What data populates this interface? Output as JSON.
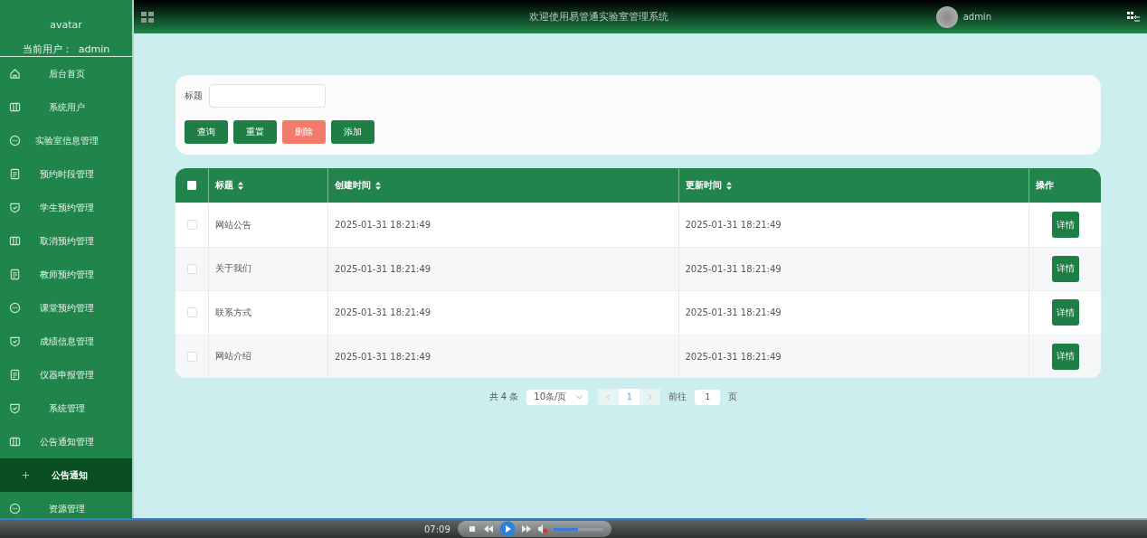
{
  "sidebar": {
    "avatar_alt": "avatar",
    "current_user": "当前用户：  admin",
    "items": [
      {
        "label": "后台首页",
        "kind": "home",
        "selected": false
      },
      {
        "label": "系统用户",
        "kind": "columns",
        "selected": false
      },
      {
        "label": "实验室信息管理",
        "kind": "chat",
        "selected": false
      },
      {
        "label": "预约时段管理",
        "kind": "doc",
        "selected": false
      },
      {
        "label": "学生预约管理",
        "kind": "shield",
        "selected": false
      },
      {
        "label": "取消预约管理",
        "kind": "columns",
        "selected": false
      },
      {
        "label": "教师预约管理",
        "kind": "doc",
        "selected": false
      },
      {
        "label": "课堂预约管理",
        "kind": "chat",
        "selected": false
      },
      {
        "label": "成绩信息管理",
        "kind": "shield",
        "selected": false
      },
      {
        "label": "仪器申报管理",
        "kind": "doc",
        "selected": false
      },
      {
        "label": "系统管理",
        "kind": "shield",
        "selected": false
      },
      {
        "label": "公告通知管理",
        "kind": "columns",
        "selected": false
      },
      {
        "label": "公告通知",
        "kind": "sub",
        "selected": true
      },
      {
        "label": "资源管理",
        "kind": "chat",
        "selected": false
      }
    ]
  },
  "header": {
    "title": "欢迎使用易管通实验室管理系统",
    "user": "admin"
  },
  "search": {
    "label": "标题",
    "buttons": [
      {
        "label": "查询",
        "kind": "primary"
      },
      {
        "label": "重置",
        "kind": "primary"
      },
      {
        "label": "删除",
        "kind": "danger"
      },
      {
        "label": "添加",
        "kind": "primary"
      }
    ]
  },
  "table": {
    "all_checked": false,
    "columns": [
      "标题",
      "创建时间",
      "更新时间",
      "操作"
    ],
    "rows": [
      {
        "title": "网站公告",
        "created": "2025-01-31 18:21:49",
        "updated": "2025-01-31 18:21:49",
        "action": "详情",
        "checked": false
      },
      {
        "title": "关于我们",
        "created": "2025-01-31 18:21:49",
        "updated": "2025-01-31 18:21:49",
        "action": "详情",
        "checked": false
      },
      {
        "title": "联系方式",
        "created": "2025-01-31 18:21:49",
        "updated": "2025-01-31 18:21:49",
        "action": "详情",
        "checked": false
      },
      {
        "title": "网站介绍",
        "created": "2025-01-31 18:21:49",
        "updated": "2025-01-31 18:21:49",
        "action": "详情",
        "checked": false
      }
    ]
  },
  "pagination": {
    "total": "共 4 条",
    "page_size": "10条/页",
    "current_page": "1",
    "goto_label": "前往",
    "goto_value": "1",
    "page_suffix": "页"
  },
  "player": {
    "time": "07:09",
    "progress": {
      "level": 0.755
    },
    "volume": {
      "level": 0.5
    }
  }
}
